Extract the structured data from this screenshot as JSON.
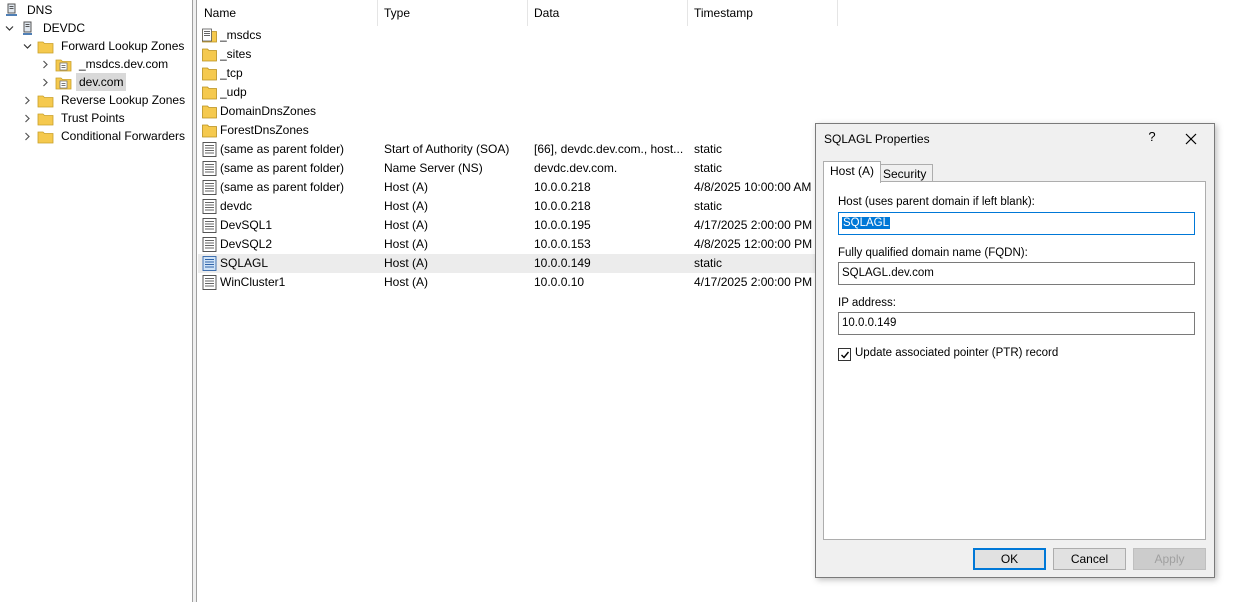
{
  "tree": {
    "root": "DNS",
    "server": "DEVDC",
    "forward_zones": "Forward Lookup Zones",
    "msdcs_zone": "_msdcs.dev.com",
    "dev_zone": "dev.com",
    "reverse_zones": "Reverse Lookup Zones",
    "trust_points": "Trust Points",
    "conditional_forwarders": "Conditional Forwarders"
  },
  "list": {
    "columns": [
      "Name",
      "Type",
      "Data",
      "Timestamp"
    ],
    "rows": [
      {
        "name": "_msdcs",
        "type": "",
        "data": "",
        "timestamp": "",
        "icon": "delegated-folder-icon"
      },
      {
        "name": "_sites",
        "type": "",
        "data": "",
        "timestamp": "",
        "icon": "folder-icon"
      },
      {
        "name": "_tcp",
        "type": "",
        "data": "",
        "timestamp": "",
        "icon": "folder-icon"
      },
      {
        "name": "_udp",
        "type": "",
        "data": "",
        "timestamp": "",
        "icon": "folder-icon"
      },
      {
        "name": "DomainDnsZones",
        "type": "",
        "data": "",
        "timestamp": "",
        "icon": "folder-icon"
      },
      {
        "name": "ForestDnsZones",
        "type": "",
        "data": "",
        "timestamp": "",
        "icon": "folder-icon"
      },
      {
        "name": "(same as parent folder)",
        "type": "Start of Authority (SOA)",
        "data": "[66], devdc.dev.com., host...",
        "timestamp": "static",
        "icon": "record-icon"
      },
      {
        "name": "(same as parent folder)",
        "type": "Name Server (NS)",
        "data": "devdc.dev.com.",
        "timestamp": "static",
        "icon": "record-icon"
      },
      {
        "name": "(same as parent folder)",
        "type": "Host (A)",
        "data": "10.0.0.218",
        "timestamp": "4/8/2025 10:00:00 AM",
        "icon": "record-icon"
      },
      {
        "name": "devdc",
        "type": "Host (A)",
        "data": "10.0.0.218",
        "timestamp": "static",
        "icon": "record-icon"
      },
      {
        "name": "DevSQL1",
        "type": "Host (A)",
        "data": "10.0.0.195",
        "timestamp": "4/17/2025 2:00:00 PM",
        "icon": "record-icon"
      },
      {
        "name": "DevSQL2",
        "type": "Host (A)",
        "data": "10.0.0.153",
        "timestamp": "4/8/2025 12:00:00 PM",
        "icon": "record-icon"
      },
      {
        "name": "SQLAGL",
        "type": "Host (A)",
        "data": "10.0.0.149",
        "timestamp": "static",
        "icon": "record-icon",
        "selected": true
      },
      {
        "name": "WinCluster1",
        "type": "Host (A)",
        "data": "10.0.0.10",
        "timestamp": "4/17/2025 2:00:00 PM",
        "icon": "record-icon"
      }
    ]
  },
  "dialog": {
    "title": "SQLAGL Properties",
    "help": "?",
    "tabs": [
      "Host (A)",
      "Security"
    ],
    "host_label": "Host (uses parent domain if left blank):",
    "host_value": "SQLAGL",
    "fqdn_label": "Fully qualified domain name (FQDN):",
    "fqdn_value": "SQLAGL.dev.com",
    "ip_label": "IP address:",
    "ip_value": "10.0.0.149",
    "ptr_label": "Update associated pointer (PTR) record",
    "ptr_checked": true,
    "ok": "OK",
    "cancel": "Cancel",
    "apply": "Apply"
  }
}
